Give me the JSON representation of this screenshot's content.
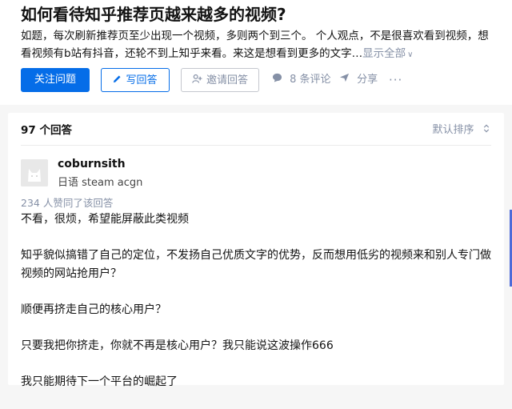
{
  "question": {
    "title": "如何看待知乎推荐页越来越多的视频?",
    "detail": "如题，每次刷新推荐页至少出现一个视频，多则两个到三个。 个人观点，不是很喜欢看到视频，想看视频有b站有抖音，还轮不到上知乎来看。来这是想看到更多的文字…",
    "show_all": "显示全部"
  },
  "actions": {
    "follow": "关注问题",
    "write_answer": "写回答",
    "invite": "邀请回答",
    "comments": "8 条评论",
    "share": "分享",
    "more": "···"
  },
  "list": {
    "count": "97 个回答",
    "sort": "默认排序"
  },
  "answer": {
    "author": "coburnsith",
    "bio": "日语 steam acgn",
    "votes": "234 人赞同了该回答",
    "paragraphs": [
      "不看，很烦，希望能屏蔽此类视频",
      "知乎貌似搞错了自己的定位，不发扬自己优质文字的优势，反而想用低劣的视频来和别人专门做视频的网站抢用户？",
      "顺便再挤走自己的核心用户？",
      "只要我把你挤走，你就不再是核心用户？我只能说这波操作666",
      "我只能期待下一个平台的崛起了"
    ]
  },
  "colors": {
    "brand": "#056de8",
    "muted": "#8590a6"
  },
  "icons": {
    "write": "pencil-icon",
    "invite": "add-user-icon",
    "comment": "comment-icon",
    "share": "send-icon",
    "sort": "sort-toggle-icon",
    "expand": "chevron-down-icon"
  }
}
